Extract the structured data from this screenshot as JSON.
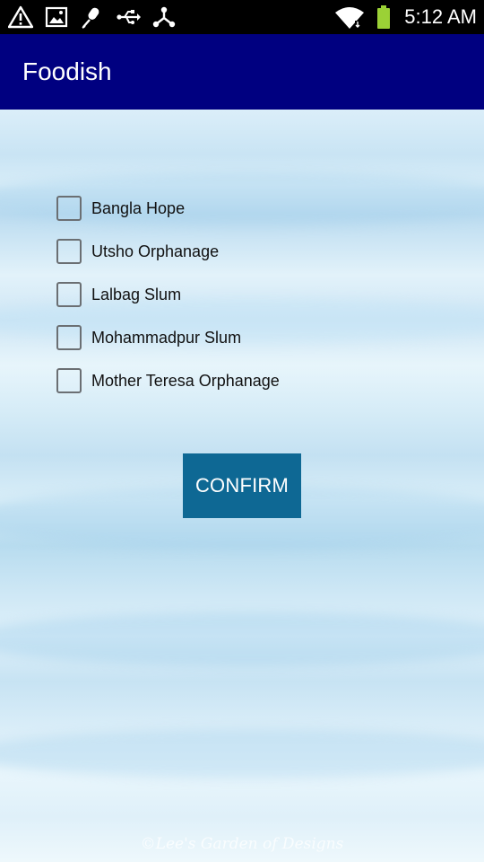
{
  "status_bar": {
    "time": "5:12 AM",
    "icons_left": [
      "warning-icon",
      "image-icon",
      "microphone-off-icon",
      "usb-icon",
      "share-network-icon"
    ],
    "icons_right": [
      "wifi-icon",
      "battery-icon"
    ]
  },
  "app_bar": {
    "title": "Foodish",
    "color": "#000080"
  },
  "options": [
    {
      "label": "Bangla Hope",
      "checked": false
    },
    {
      "label": "Utsho Orphanage",
      "checked": false
    },
    {
      "label": "Lalbag Slum",
      "checked": false
    },
    {
      "label": "Mohammadpur Slum",
      "checked": false
    },
    {
      "label": "Mother Teresa Orphanage",
      "checked": false
    }
  ],
  "confirm_button": {
    "label": "CONFIRM",
    "color": "#0e6894"
  },
  "background": {
    "watermark": "©Lee's Garden of Designs"
  }
}
